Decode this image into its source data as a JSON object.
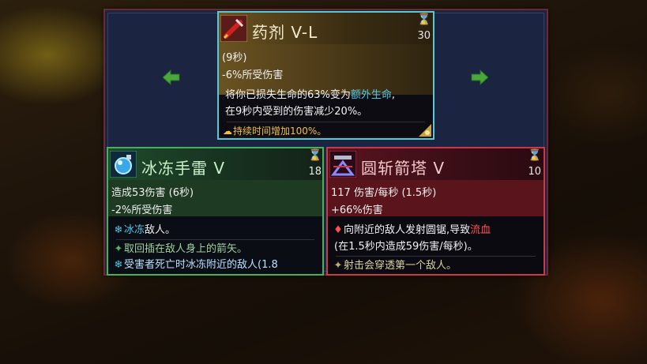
{
  "colors": {
    "potion_border": "#57c8d8",
    "grenade_border": "#46b05a",
    "turret_border": "#c83a48",
    "arrow_green": "#4aa83a",
    "highlight_cyan": "#52c8e8",
    "highlight_red": "#ff5050"
  },
  "nav": {
    "left_icon": "arrow-left-icon",
    "right_icon": "arrow-right-icon"
  },
  "potion": {
    "icon": "potion-icon",
    "title": "药剂 V-L",
    "cooldown": "30",
    "stat1": "(9秒)",
    "stat2": "-6%所受伤害",
    "desc_line1_a": "将你已损失生命的63%变为",
    "desc_line1_hl": "额外生命",
    "desc_line1_b": ",",
    "desc_line2": "在9秒内受到的伤害减少20%。",
    "bonus": "持续时间增加100%。"
  },
  "grenade": {
    "icon": "ice-grenade-icon",
    "title": "冰冻手雷 V",
    "cooldown": "18",
    "stat1": "造成53伤害 (6秒)",
    "stat2": "-2%所受伤害",
    "effect_hl": "冰冻",
    "effect_rest": "敌人。",
    "note1": "取回插在敌人身上的箭矢。",
    "note2": "受害者死亡时冰冻附近的敌人(1.8"
  },
  "turret": {
    "icon": "saw-turret-icon",
    "title": "圆斩箭塔 V",
    "cooldown": "10",
    "stat1": "117 伤害/每秒 (1.5秒)",
    "stat2": "+66%伤害",
    "effect_a": "向附近的敌人发射圆锯,导致",
    "effect_hl": "流血",
    "effect_line2": "(在1.5秒内造成59伤害/每秒)。",
    "note1": "射击会穿透第一个敌人。"
  }
}
